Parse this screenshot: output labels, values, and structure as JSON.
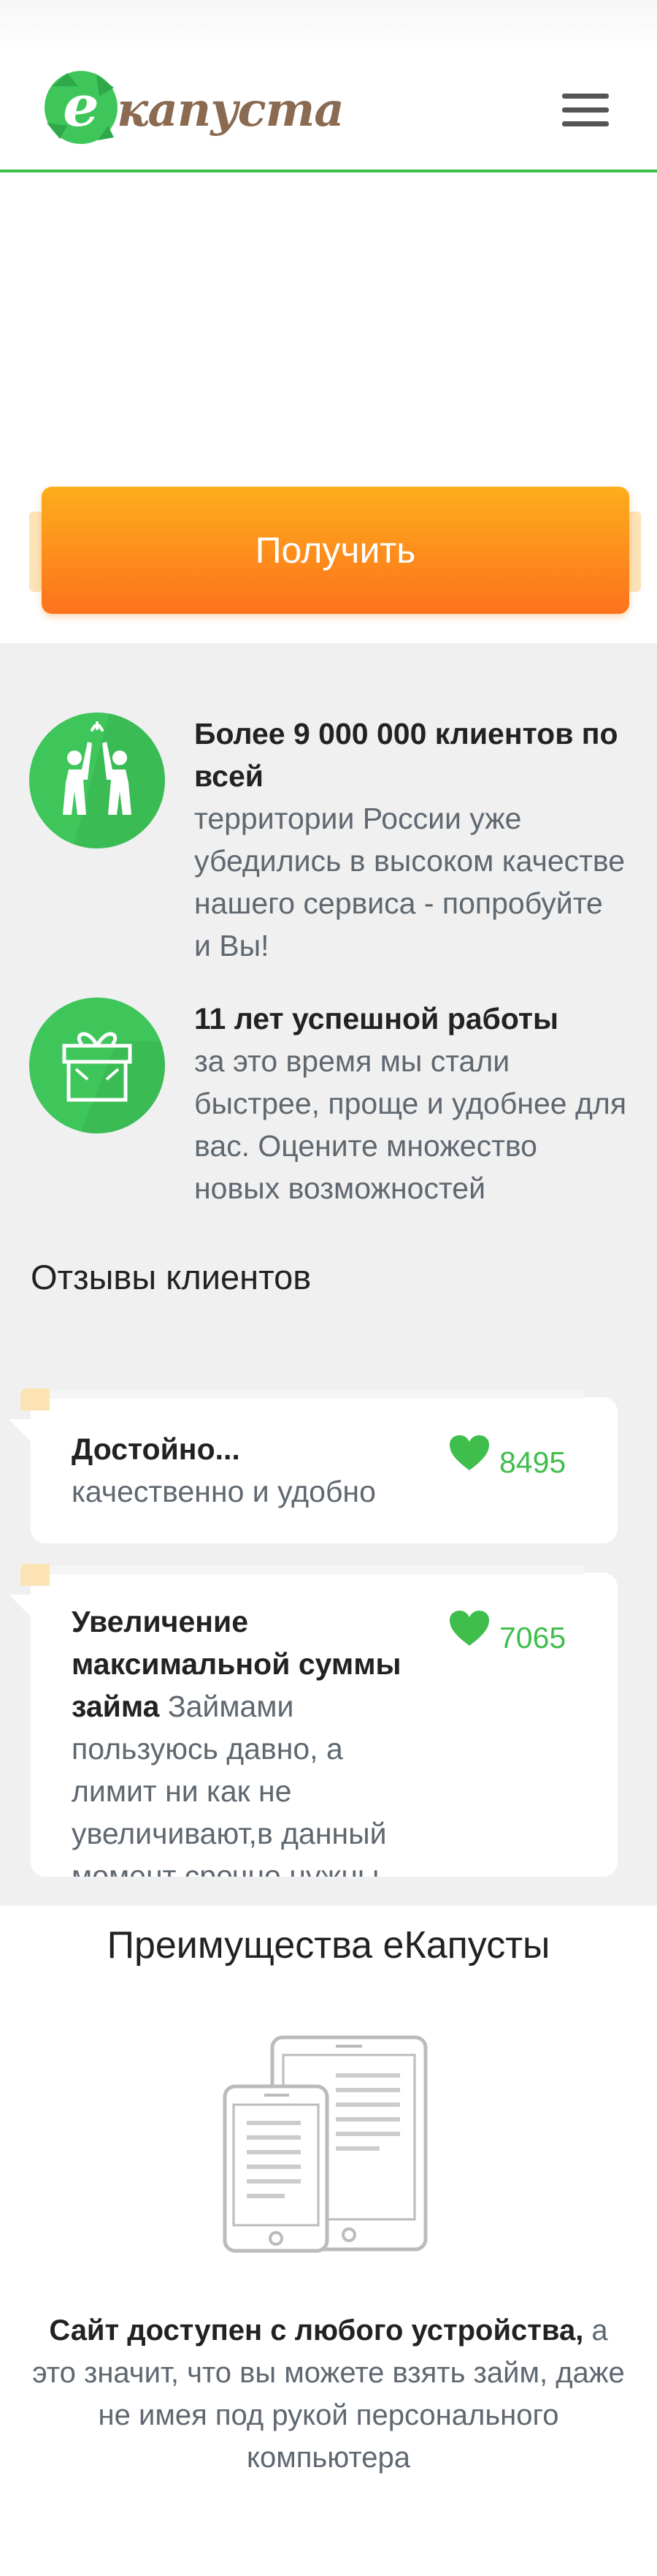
{
  "header": {
    "logo_text": "капуста",
    "logo_letter": "е",
    "brand_color": "#3fbe4c"
  },
  "cta": {
    "button_label": "Получить"
  },
  "features": [
    {
      "title": "Более 9 000 000 клиентов по всей",
      "description": "территории России уже убедились в высоком качестве нашего сервиса - попробуйте и Вы!",
      "icon": "high-five-icon"
    },
    {
      "title": "11 лет успешной работы",
      "description": "за это время мы стали быстрее, проще и удобнее для вас. Оцените множество новых возможностей",
      "icon": "gift-icon"
    }
  ],
  "reviews": {
    "title": "Отзывы клиентов",
    "items": [
      {
        "title": "Достойно...",
        "text": "качественно и удобно",
        "likes": "8495"
      },
      {
        "title": "Увеличение максимальной суммы займа",
        "text": "Займами пользуюсь давно, а лимит ни как не увеличивают,в данный момент срочно нужны",
        "likes": "7065"
      }
    ]
  },
  "advantages": {
    "title": "Преимущества еКапусты",
    "text_bold": "Сайт доступен с любого устройства,",
    "text_rest": " а это значит, что вы можете взять займ, даже не имея под рукой персонального компьютера"
  },
  "colors": {
    "accent_green": "#3ec65a",
    "cta_orange": "#fd8c1c"
  }
}
